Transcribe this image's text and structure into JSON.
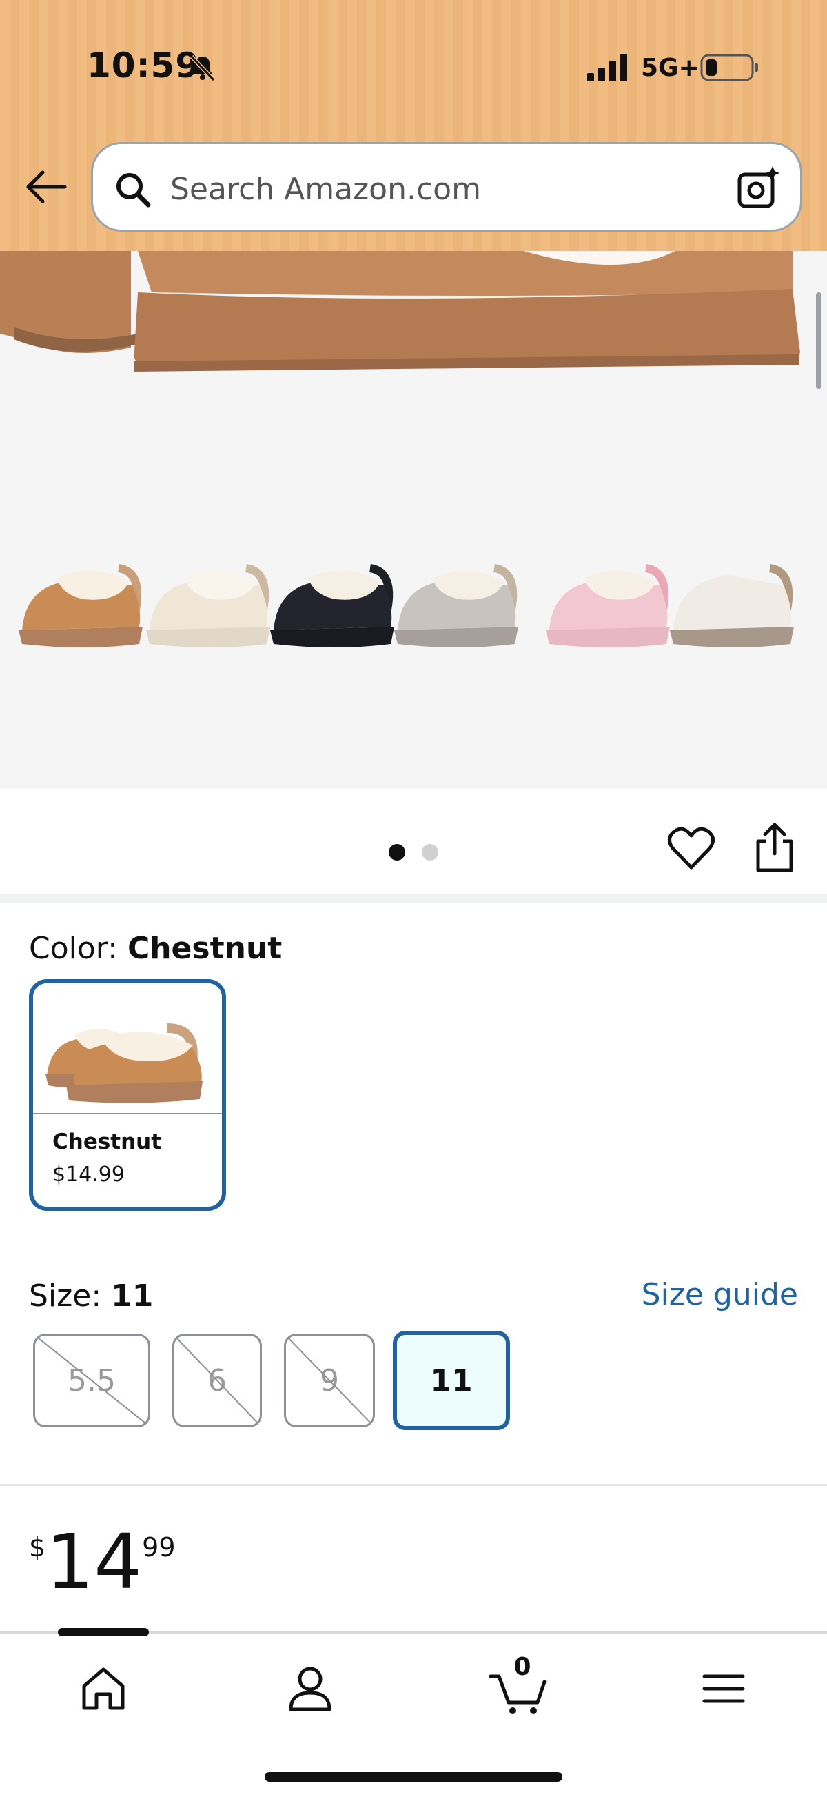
{
  "status_bar": {
    "time": "10:59",
    "network": "5G+"
  },
  "search": {
    "placeholder": "Search Amazon.com"
  },
  "product_gallery": {
    "thumbnails": [
      "chestnut",
      "cream",
      "black",
      "grey",
      "pink",
      "white-sherpa"
    ],
    "active_page": 1,
    "page_count": 2
  },
  "color": {
    "label": "Color:",
    "selected": "Chestnut",
    "options": [
      {
        "name": "Chestnut",
        "price": "$14.99"
      }
    ]
  },
  "size": {
    "label": "Size:",
    "selected": "11",
    "guide_link": "Size guide",
    "options": [
      {
        "value": "5.5",
        "available": false
      },
      {
        "value": "6",
        "available": false
      },
      {
        "value": "9",
        "available": false
      },
      {
        "value": "11",
        "available": true
      }
    ]
  },
  "price": {
    "symbol": "$",
    "whole": "14",
    "fraction": "99"
  },
  "bottom_nav": {
    "items": [
      "home",
      "account",
      "cart",
      "menu"
    ],
    "cart_count": "0"
  },
  "colors": {
    "header_bg": "#f0bc82",
    "accent_blue": "#2162a1",
    "selected_bg": "#edfdff"
  }
}
